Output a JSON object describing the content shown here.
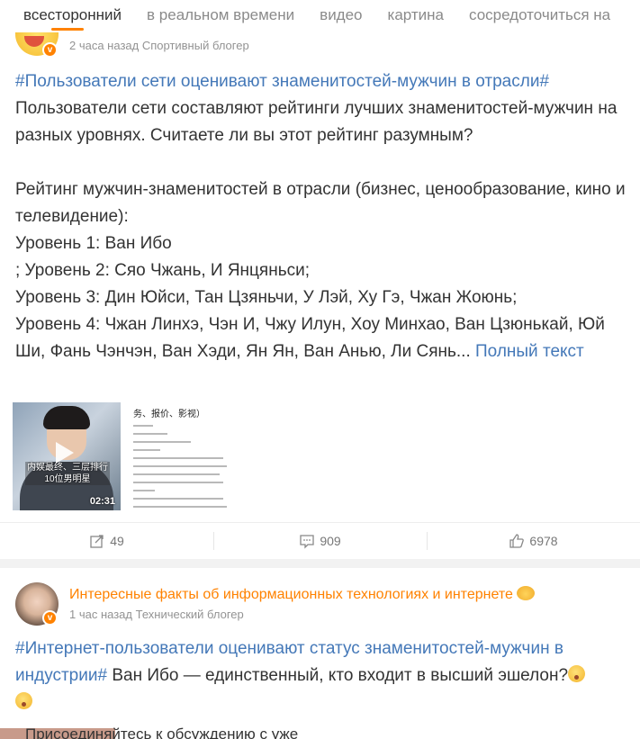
{
  "tabs": [
    "всесторонний",
    "в реальном времени",
    "видео",
    "картина",
    "сосредоточиться на"
  ],
  "post1": {
    "meta": "2 часа назад Спортивный блогер",
    "hashtag": "#Пользователи сети оценивают знаменитостей-мужчин в отрасли#",
    "lines": [
      "Пользователи сети составляют рейтинги лучших знаменитостей-мужчин на разных уровнях. Считаете ли вы этот рейтинг разумным?",
      "",
      "Рейтинг мужчин-знаменитостей в отрасли (бизнес, ценообразование, кино и телевидение):",
      "Уровень 1: Ван Ибо",
      "; Уровень 2: Сяо Чжань, И Янцяньси;",
      "Уровень 3: Дин Юйси, Тан Цзяньчи, У Лэй, Ху Гэ, Чжан Жоюнь;"
    ],
    "last_line": "Уровень 4: Чжан Линхэ, Чэн И, Чжу Илун, Хоу Минхао, Ван Цзюнькай, Юй Ши, Фань Чэнчэн, Ван Хэди, Ян Ян, Ван Анью, Ли Сянь...",
    "full_text_link": "Полный текст",
    "video_caption": "内娱最终、三层排行 10位男明星",
    "video_duration": "02:31",
    "doc_title": "务、报价、影视）",
    "actions": {
      "repost": "49",
      "comments": "909",
      "likes": "6978"
    }
  },
  "post2": {
    "author": "Интересные факты об информационных технологиях и интернете",
    "meta": "1 час назад Технический блогер",
    "hashtag": "#Интернет-пользователи оценивают статус знаменитостей-мужчин в индустрии#",
    "text": " Ван Ибо — единственный, кто входит в высший эшелон?",
    "cutoff_text": "Присоединяйтесь к обсуждению с уже"
  },
  "colors": {
    "accent": "#ff8200",
    "link": "#4478b8",
    "muted": "#939393"
  },
  "icons": {
    "verified": "verified-badge-icon",
    "repost": "repost-icon",
    "comment": "comment-icon",
    "like": "like-icon",
    "play": "play-icon"
  }
}
